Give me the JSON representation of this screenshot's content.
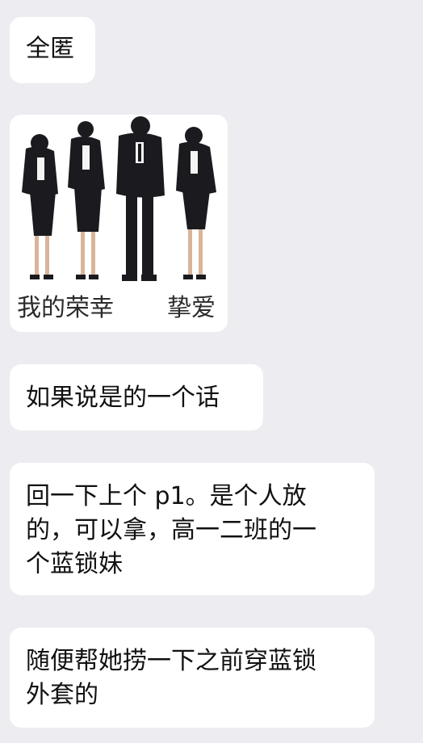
{
  "chat": {
    "messages": [
      {
        "text": "全匿"
      },
      {
        "sticker": {
          "caption_left": "我的荣幸",
          "caption_right": "挚爱"
        }
      },
      {
        "text": "如果说是的一个话"
      },
      {
        "lines": [
          "回一下上个 p1。是个人放",
          "的，可以拿，高一二班的一",
          "个蓝锁妹"
        ]
      },
      {
        "lines": [
          "随便帮她捞一下之前穿蓝锁",
          "外套的"
        ]
      }
    ]
  }
}
